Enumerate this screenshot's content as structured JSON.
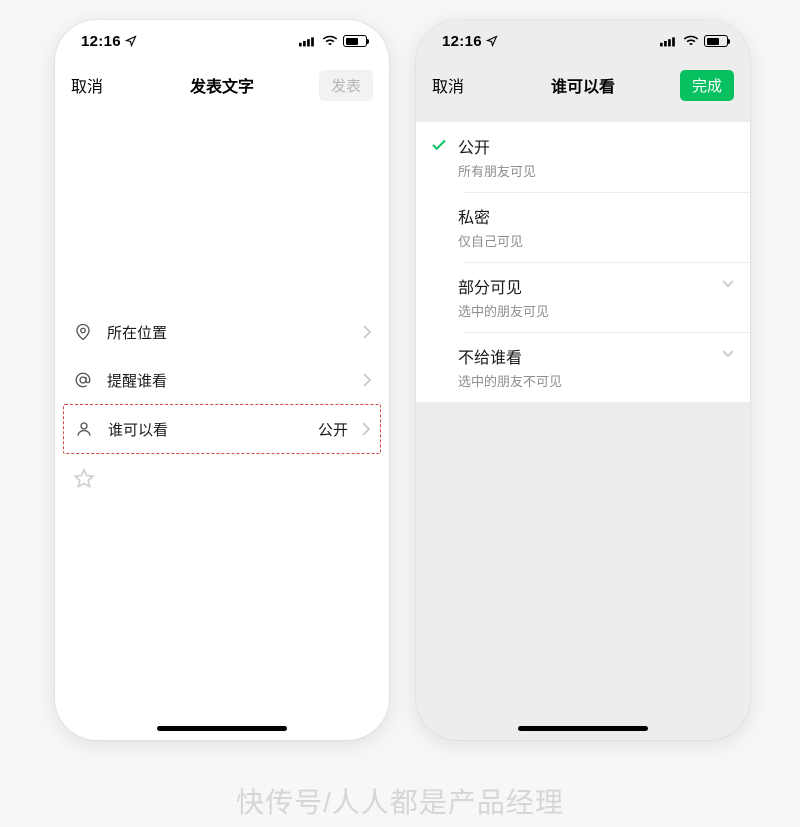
{
  "status": {
    "time": "12:16",
    "arrow": "↗"
  },
  "left": {
    "nav": {
      "cancel": "取消",
      "title": "发表文字",
      "publish": "发表"
    },
    "rows": {
      "location": "所在位置",
      "mention": "提醒谁看",
      "visibility": {
        "label": "谁可以看",
        "value": "公开"
      }
    }
  },
  "right": {
    "nav": {
      "cancel": "取消",
      "title": "谁可以看",
      "done": "完成"
    },
    "options": [
      {
        "title": "公开",
        "sub": "所有朋友可见",
        "checked": true,
        "expandable": false
      },
      {
        "title": "私密",
        "sub": "仅自己可见",
        "checked": false,
        "expandable": false
      },
      {
        "title": "部分可见",
        "sub": "选中的朋友可见",
        "checked": false,
        "expandable": true
      },
      {
        "title": "不给谁看",
        "sub": "选中的朋友不可见",
        "checked": false,
        "expandable": true
      }
    ]
  },
  "watermark": "快传号/人人都是产品经理"
}
